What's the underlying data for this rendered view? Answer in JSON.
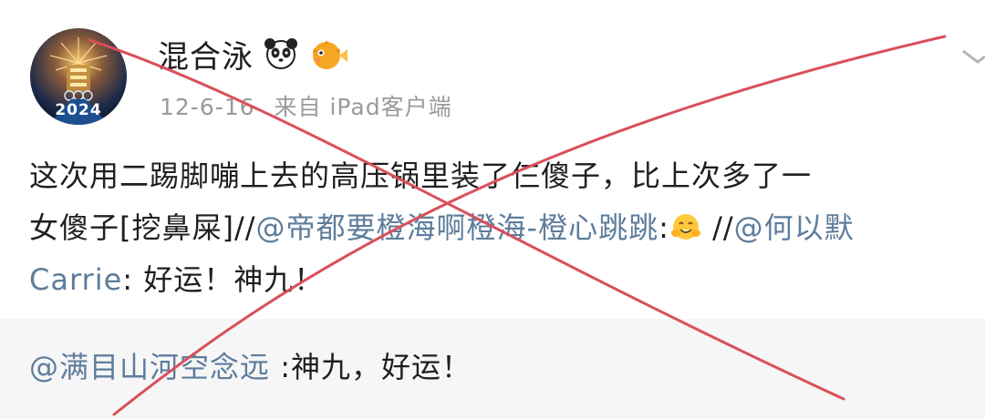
{
  "post": {
    "avatar_badge": "2024",
    "username": "混合泳",
    "username_emojis": [
      "panda-icon",
      "pufferfish-icon"
    ],
    "meta": {
      "date": "12-6-16",
      "source": "来自 iPad客户端"
    },
    "content": {
      "line1": "这次用二踢脚嘣上去的高压锅里装了仨傻子，比上次多了一",
      "line2_text": "女傻子[挖鼻屎]",
      "slashes1": "//",
      "mention1": "@帝都要橙海啊橙海-橙心跳跳",
      "colon1": ":",
      "emoji1": "hug-emoji-icon",
      "slashes2": "//",
      "mention2_part1": "@何以默",
      "mention2_part2": "Carrie",
      "after_mention2": ": 好运！神九！"
    },
    "repost": {
      "mention": "@满目山河空念远",
      "text": " :神九，好运！"
    }
  },
  "colors": {
    "mention": "#5e7d9c",
    "cross_line": "#d9505a",
    "repost_bg": "#f6f6f6",
    "meta_text": "#9a9a9a"
  }
}
